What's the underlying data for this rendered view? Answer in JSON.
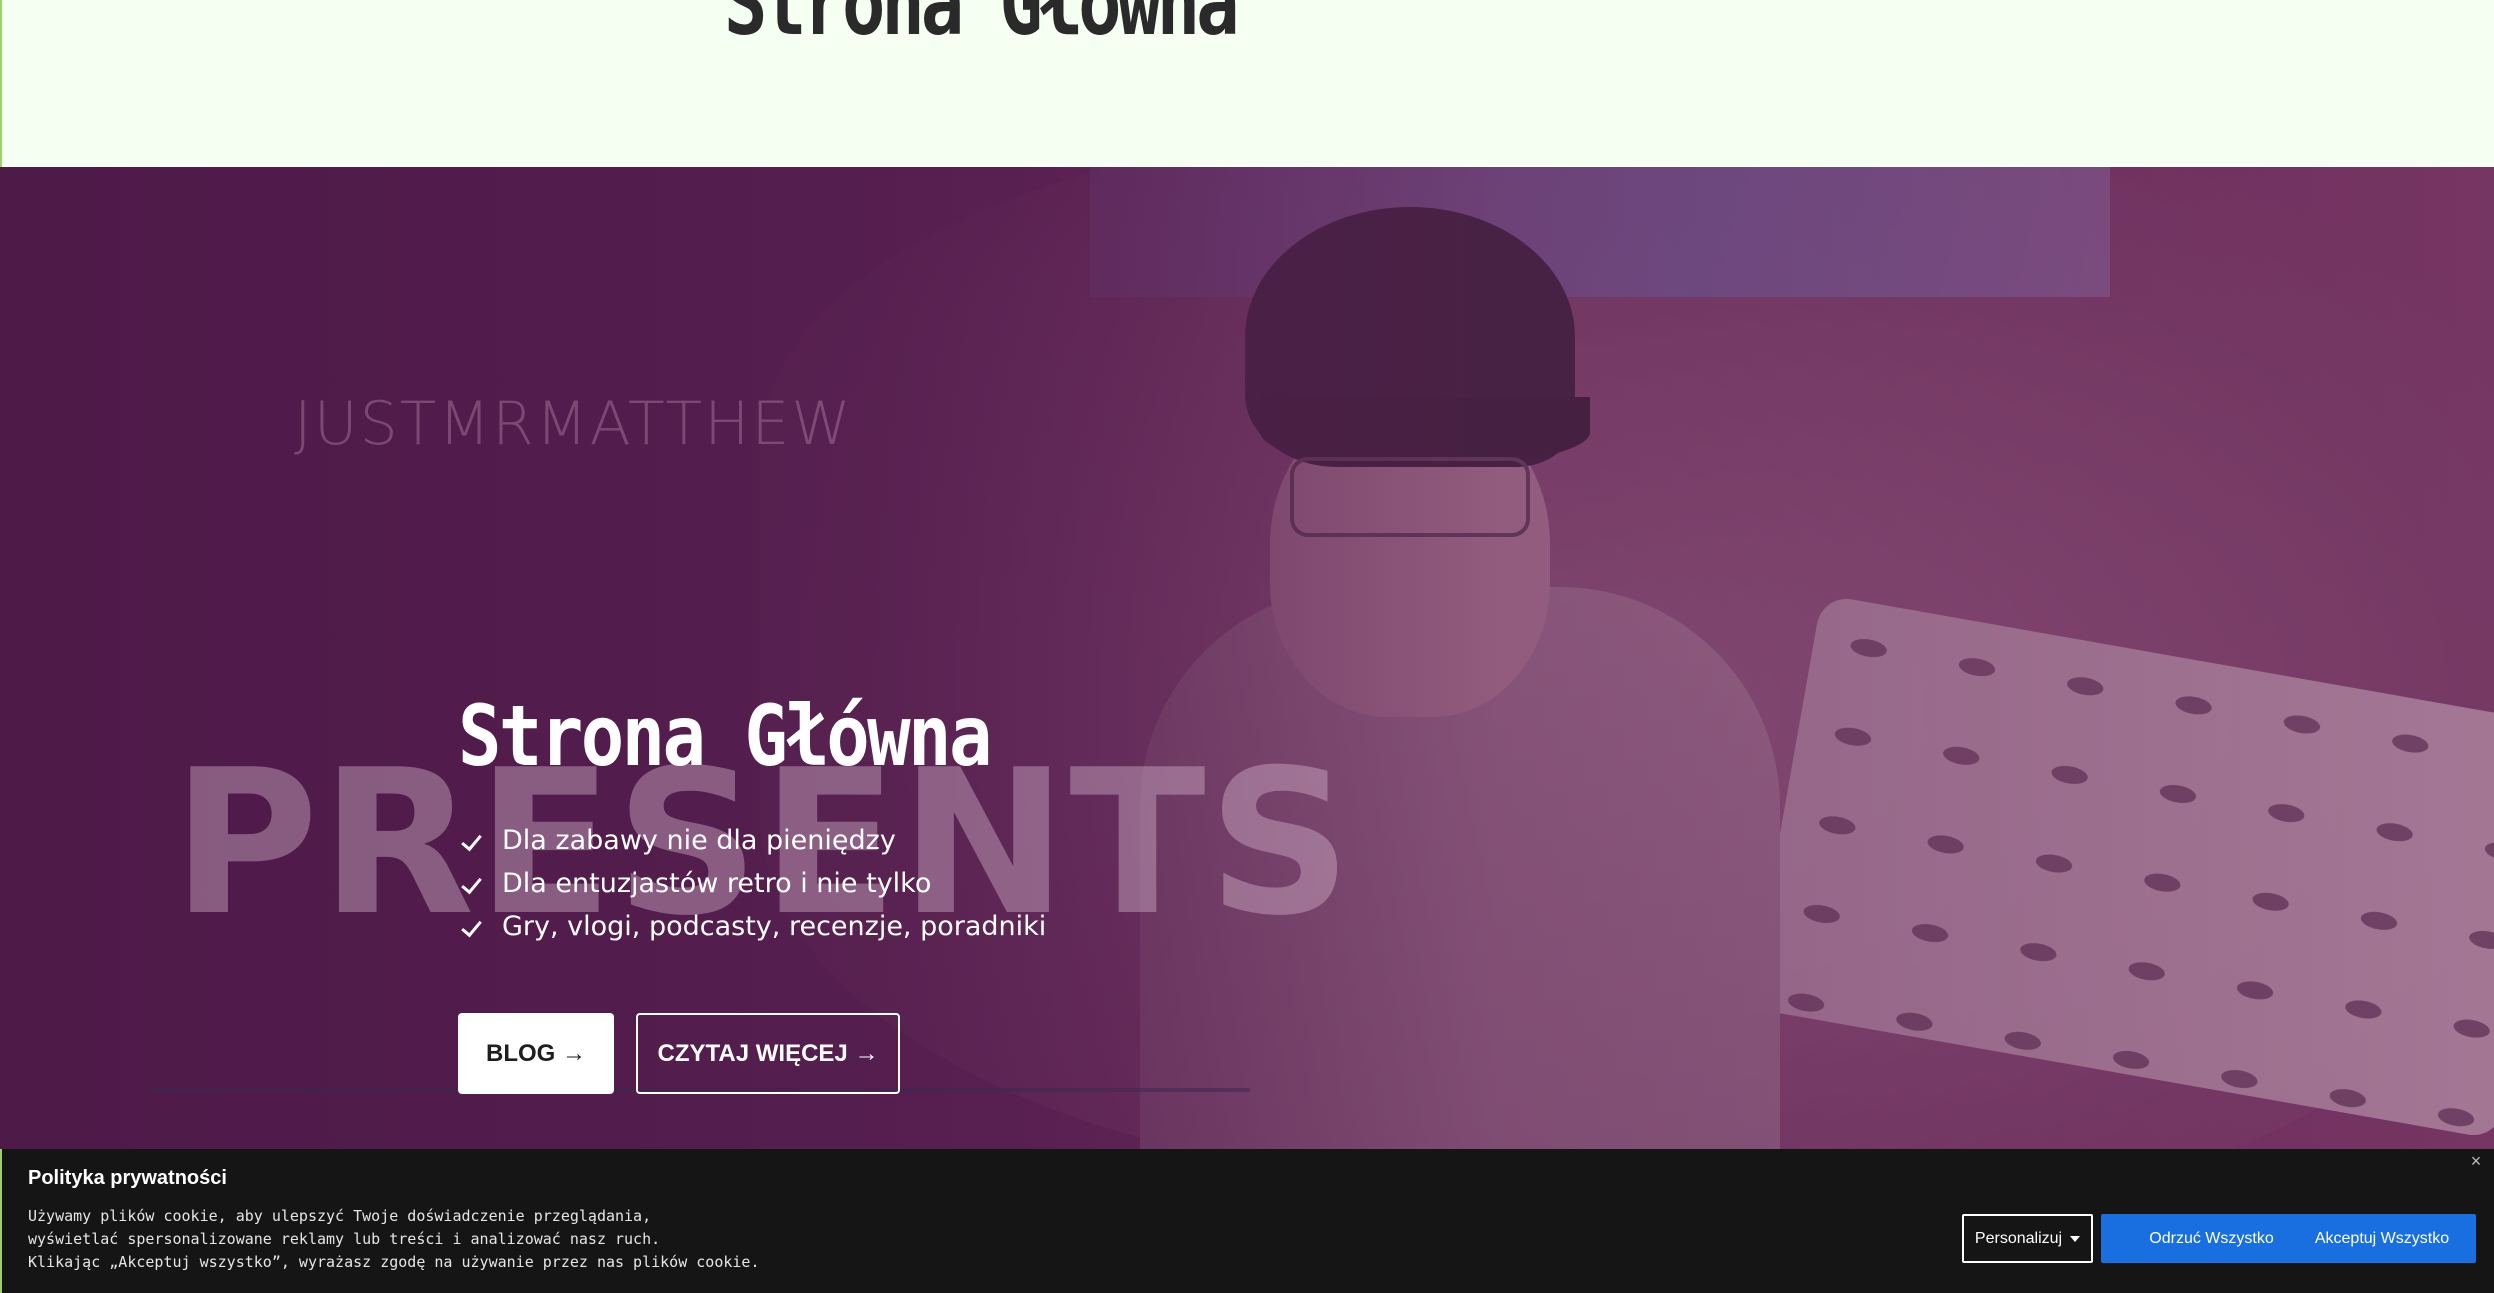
{
  "header": {
    "page_title": "Strona Główna"
  },
  "hero": {
    "brand_watermark": "JUSTMRMATTHEW",
    "presents_watermark": "PRESENTS",
    "title": "Strona Główna",
    "features": [
      "Dla zabawy nie dla pieniędzy",
      "Dla entuzjastów retro i nie tylko",
      "Gry, vlogi, podcasty, recenzje, poradniki"
    ],
    "buttons": {
      "blog": "BLOG →",
      "read_more": "CZYTAJ WIĘCEJ →"
    }
  },
  "cookie_banner": {
    "title": "Polityka prywatności",
    "text_lines": [
      "Używamy plików cookie, aby ulepszyć Twoje doświadczenie przeglądania,",
      "wyświetlać spersonalizowane reklamy lub treści i analizować nasz ruch.",
      "Klikając „Akceptuj wszystko”, wyrażasz zgodę na używanie przez nas plików cookie."
    ],
    "close_label": "×",
    "personalize_label": "Personalizuj",
    "reject_label": "Odrzuć Wszystko",
    "accept_label": "Akceptuj Wszystko"
  },
  "colors": {
    "accent_button": "#1a6fe0",
    "hero_overlay": "#4e1a48",
    "cookie_bg": "#151515",
    "page_bg": "#f5fff2"
  }
}
